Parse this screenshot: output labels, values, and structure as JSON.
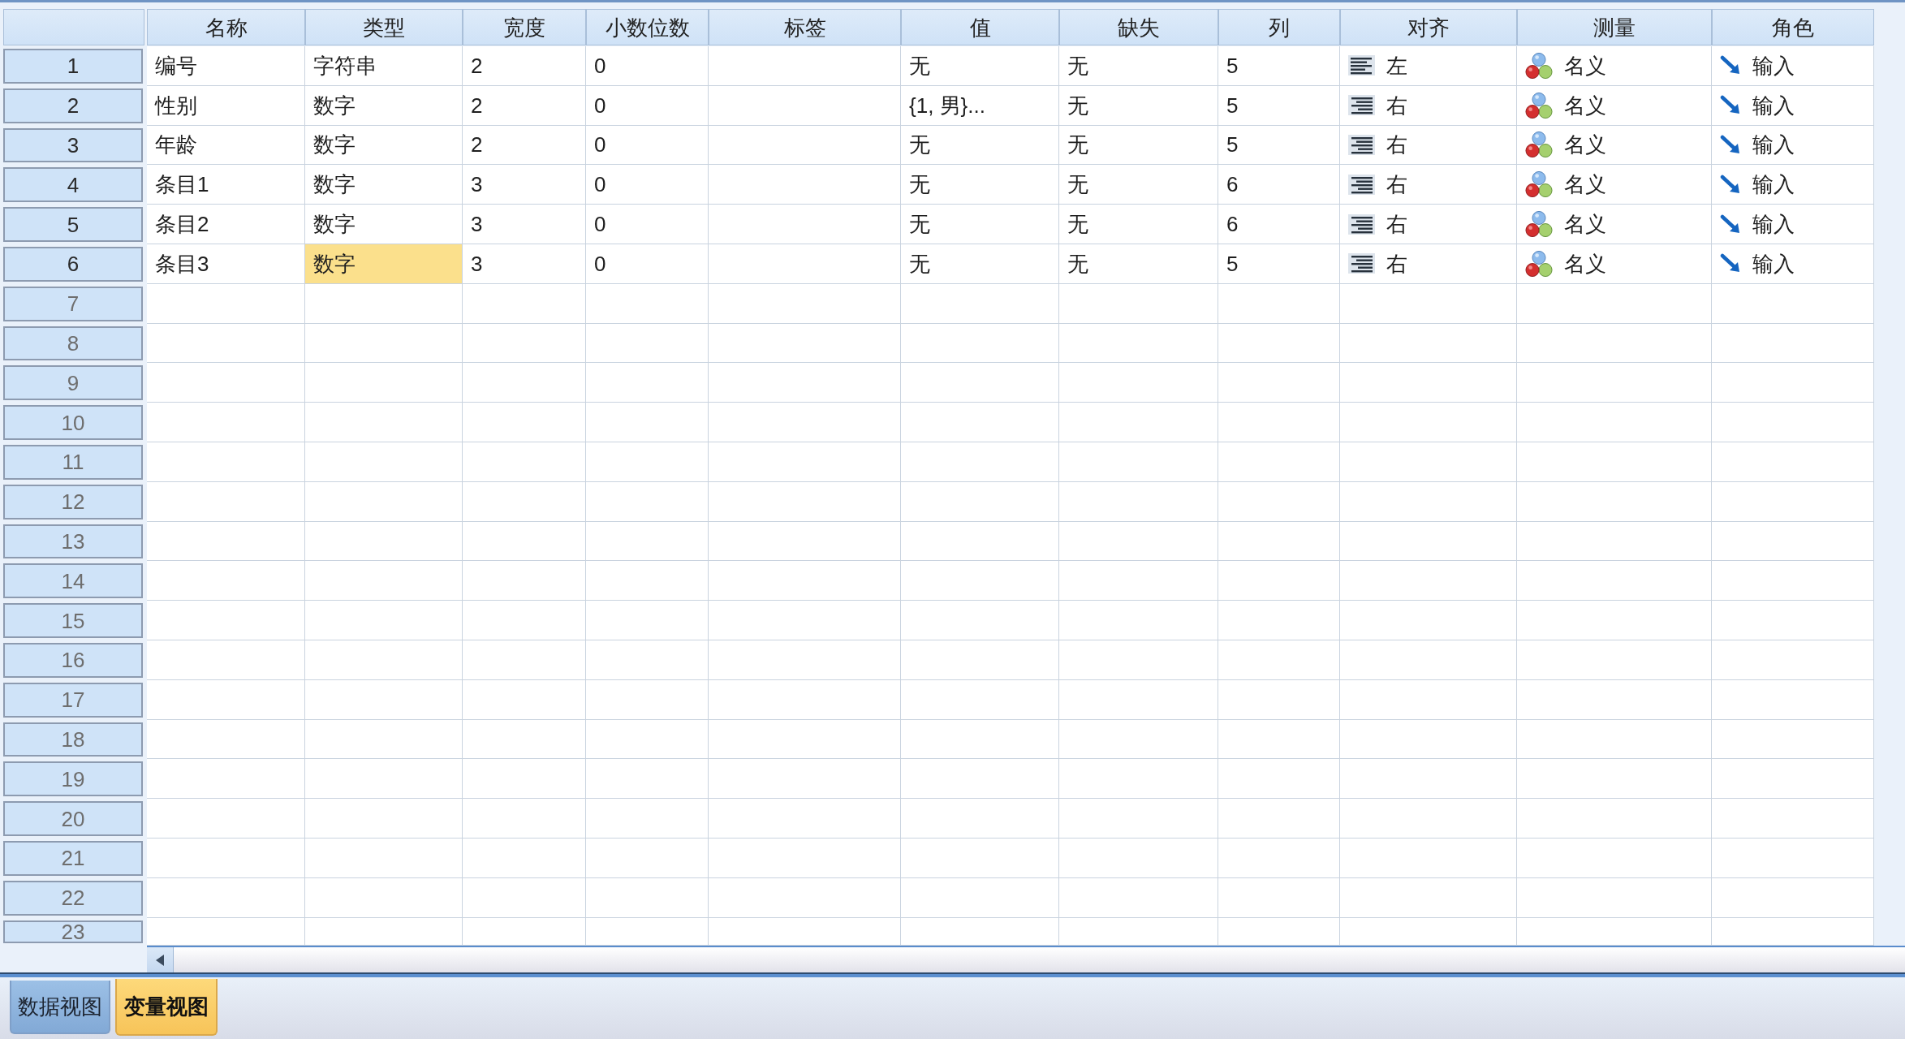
{
  "columns": [
    "名称",
    "类型",
    "宽度",
    "小数位数",
    "标签",
    "值",
    "缺失",
    "列",
    "对齐",
    "测量",
    "角色"
  ],
  "rows": [
    {
      "number": "1",
      "kind": "variable",
      "cells": [
        {
          "text": "编号",
          "kind": "text",
          "selected": false
        },
        {
          "text": "字符串",
          "kind": "text",
          "selected": false
        },
        {
          "text": "2",
          "kind": "text",
          "selected": false
        },
        {
          "text": "0",
          "kind": "text",
          "selected": false
        },
        {
          "kind": "blank",
          "selected": false
        },
        {
          "text": "无",
          "kind": "text",
          "selected": false
        },
        {
          "text": "无",
          "kind": "text",
          "selected": false
        },
        {
          "text": "5",
          "kind": "text",
          "selected": false
        },
        {
          "text": "左",
          "kind": "alignleft",
          "selected": false
        },
        {
          "text": "名义",
          "kind": "nominal",
          "selected": false
        },
        {
          "text": "输入",
          "kind": "input",
          "selected": false
        }
      ]
    },
    {
      "number": "2",
      "kind": "variable",
      "cells": [
        {
          "text": "性别",
          "kind": "text",
          "selected": false
        },
        {
          "text": "数字",
          "kind": "text",
          "selected": false
        },
        {
          "text": "2",
          "kind": "text",
          "selected": false
        },
        {
          "text": "0",
          "kind": "text",
          "selected": false
        },
        {
          "kind": "blank",
          "selected": false
        },
        {
          "text": "{1, 男}...",
          "kind": "text",
          "selected": false
        },
        {
          "text": "无",
          "kind": "text",
          "selected": false
        },
        {
          "text": "5",
          "kind": "text",
          "selected": false
        },
        {
          "text": "右",
          "kind": "alignright",
          "selected": false
        },
        {
          "text": "名义",
          "kind": "nominal",
          "selected": false
        },
        {
          "text": "输入",
          "kind": "input",
          "selected": false
        }
      ]
    },
    {
      "number": "3",
      "kind": "variable",
      "cells": [
        {
          "text": "年龄",
          "kind": "text",
          "selected": false
        },
        {
          "text": "数字",
          "kind": "text",
          "selected": false
        },
        {
          "text": "2",
          "kind": "text",
          "selected": false
        },
        {
          "text": "0",
          "kind": "text",
          "selected": false
        },
        {
          "kind": "blank",
          "selected": false
        },
        {
          "text": "无",
          "kind": "text",
          "selected": false
        },
        {
          "text": "无",
          "kind": "text",
          "selected": false
        },
        {
          "text": "5",
          "kind": "text",
          "selected": false
        },
        {
          "text": "右",
          "kind": "alignright",
          "selected": false
        },
        {
          "text": "名义",
          "kind": "nominal",
          "selected": false
        },
        {
          "text": "输入",
          "kind": "input",
          "selected": false
        }
      ]
    },
    {
      "number": "4",
      "kind": "variable",
      "cells": [
        {
          "text": "条目1",
          "kind": "text",
          "selected": false
        },
        {
          "text": "数字",
          "kind": "text",
          "selected": false
        },
        {
          "text": "3",
          "kind": "text",
          "selected": false
        },
        {
          "text": "0",
          "kind": "text",
          "selected": false
        },
        {
          "kind": "blank",
          "selected": false
        },
        {
          "text": "无",
          "kind": "text",
          "selected": false
        },
        {
          "text": "无",
          "kind": "text",
          "selected": false
        },
        {
          "text": "6",
          "kind": "text",
          "selected": false
        },
        {
          "text": "右",
          "kind": "alignright",
          "selected": false
        },
        {
          "text": "名义",
          "kind": "nominal",
          "selected": false
        },
        {
          "text": "输入",
          "kind": "input",
          "selected": false
        }
      ]
    },
    {
      "number": "5",
      "kind": "variable",
      "cells": [
        {
          "text": "条目2",
          "kind": "text",
          "selected": false
        },
        {
          "text": "数字",
          "kind": "text",
          "selected": false
        },
        {
          "text": "3",
          "kind": "text",
          "selected": false
        },
        {
          "text": "0",
          "kind": "text",
          "selected": false
        },
        {
          "kind": "blank",
          "selected": false
        },
        {
          "text": "无",
          "kind": "text",
          "selected": false
        },
        {
          "text": "无",
          "kind": "text",
          "selected": false
        },
        {
          "text": "6",
          "kind": "text",
          "selected": false
        },
        {
          "text": "右",
          "kind": "alignright",
          "selected": false
        },
        {
          "text": "名义",
          "kind": "nominal",
          "selected": false
        },
        {
          "text": "输入",
          "kind": "input",
          "selected": false
        }
      ]
    },
    {
      "number": "6",
      "kind": "variable",
      "cells": [
        {
          "text": "条目3",
          "kind": "text",
          "selected": false
        },
        {
          "text": "数字",
          "kind": "text",
          "selected": true
        },
        {
          "text": "3",
          "kind": "text",
          "selected": false
        },
        {
          "text": "0",
          "kind": "text",
          "selected": false
        },
        {
          "kind": "blank",
          "selected": false
        },
        {
          "text": "无",
          "kind": "text",
          "selected": false
        },
        {
          "text": "无",
          "kind": "text",
          "selected": false
        },
        {
          "text": "5",
          "kind": "text",
          "selected": false
        },
        {
          "text": "右",
          "kind": "alignright",
          "selected": false
        },
        {
          "text": "名义",
          "kind": "nominal",
          "selected": false
        },
        {
          "text": "输入",
          "kind": "input",
          "selected": false
        }
      ]
    },
    {
      "number": "7",
      "kind": "empty"
    },
    {
      "number": "8",
      "kind": "empty"
    },
    {
      "number": "9",
      "kind": "empty"
    },
    {
      "number": "10",
      "kind": "empty"
    },
    {
      "number": "11",
      "kind": "empty"
    },
    {
      "number": "12",
      "kind": "empty"
    },
    {
      "number": "13",
      "kind": "empty"
    },
    {
      "number": "14",
      "kind": "empty"
    },
    {
      "number": "15",
      "kind": "empty"
    },
    {
      "number": "16",
      "kind": "empty"
    },
    {
      "number": "17",
      "kind": "empty"
    },
    {
      "number": "18",
      "kind": "empty"
    },
    {
      "number": "19",
      "kind": "empty"
    },
    {
      "number": "20",
      "kind": "empty"
    },
    {
      "number": "21",
      "kind": "empty"
    },
    {
      "number": "22",
      "kind": "empty"
    },
    {
      "number": "23",
      "kind": "empty"
    }
  ],
  "tabs": [
    {
      "label": "数据视图",
      "selected": false
    },
    {
      "label": "变量视图",
      "selected": true
    }
  ]
}
